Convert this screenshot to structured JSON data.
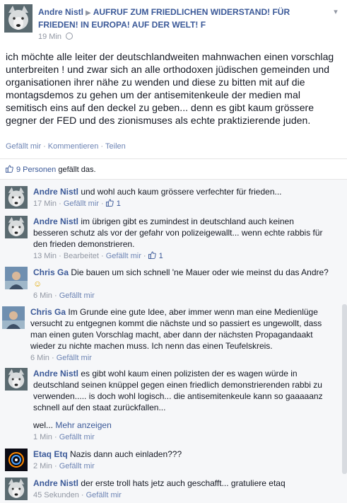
{
  "post": {
    "author": "Andre Nistl",
    "group": "AUFRUF ZUM FRIEDLICHEN WIDERSTAND! FÜR FRIEDEN! IN EUROPA! AUF DER WELT! F",
    "time": "19 Min",
    "body": "ich möchte alle leiter der deutschlandweiten mahnwachen einen vorschlag unterbreiten ! und zwar sich an alle orthodoxen jüdischen gemeinden und organisationen ihrer nähe zu wenden und diese zu bitten mit auf die montagsdemos zu gehen um der antisemitenkeule der medien mal semitisch eins auf den deckel zu geben... denn es gibt kaum grössere gegner der FED und des zionismuses als echte praktizierende juden.",
    "actions": {
      "like": "Gefällt mir",
      "comment": "Kommentieren",
      "share": "Teilen",
      "separator": "·"
    },
    "likes": {
      "count": "9 Personen",
      "suffix": "gefällt das."
    }
  },
  "comments": [
    {
      "name": "Andre Nistl",
      "text": "und wohl auch kaum grössere verfechter für frieden...",
      "time": "17 Min",
      "like": "Gefällt mir",
      "likes": "1",
      "edited": ""
    },
    {
      "name": "Andre Nistl",
      "text": "im übrigen gibt es zumindest in deutschland auch keinen besseren schutz als vor der gefahr von polizeigewallt... wenn echte rabbis für den frieden demonstrieren.",
      "time": "13 Min",
      "like": "Gefällt mir",
      "likes": "1",
      "edited": "Bearbeitet"
    },
    {
      "name": "Chris Ga",
      "text": "Die bauen um sich schnell 'ne Mauer oder wie meinst du das Andre?",
      "emoji": "☺",
      "time": "6 Min",
      "like": "Gefällt mir"
    },
    {
      "name": "Chris Ga",
      "text": "Im Grunde eine gute Idee, aber immer wenn man eine Medienlüge versucht zu entgegnen kommt die nächste und so passiert es ungewollt, dass man einen guten Vorschlag macht, aber dann der nächsten Propagandaakt wieder zu nichte machen muss. Ich nenn das einen Teufelskreis.",
      "time": "6 Min",
      "like": "Gefällt mir"
    },
    {
      "name": "Andre Nistl",
      "text": "es gibt wohl kaum einen polizisten der es wagen würde in deutschland seinen knüppel gegen einen friedlich demonstrierenden rabbi zu verwenden..... is doch wohl logisch... die antisemitenkeule kann so gaaaaanz schnell auf den staat zurückfallen...",
      "more_prefix": "wel...",
      "more": "Mehr anzeigen",
      "time": "1 Min",
      "like": "Gefällt mir"
    },
    {
      "name": "Etaq Etq",
      "text": "Nazis dann auch einladen???",
      "time": "2 Min",
      "like": "Gefällt mir"
    },
    {
      "name": "Andre Nistl",
      "text": "der erste troll hats jetz auch geschafft... gratuliere etaq",
      "time": "45 Sekunden",
      "like": "Gefällt mir"
    }
  ],
  "icons": {
    "dropdown": "chevron-down-icon",
    "audience": "globe-icon",
    "like": "thumbs-up-icon"
  },
  "colors": {
    "link": "#3b5998",
    "meta": "#9197a3",
    "comment_bg": "#f6f7f9"
  }
}
